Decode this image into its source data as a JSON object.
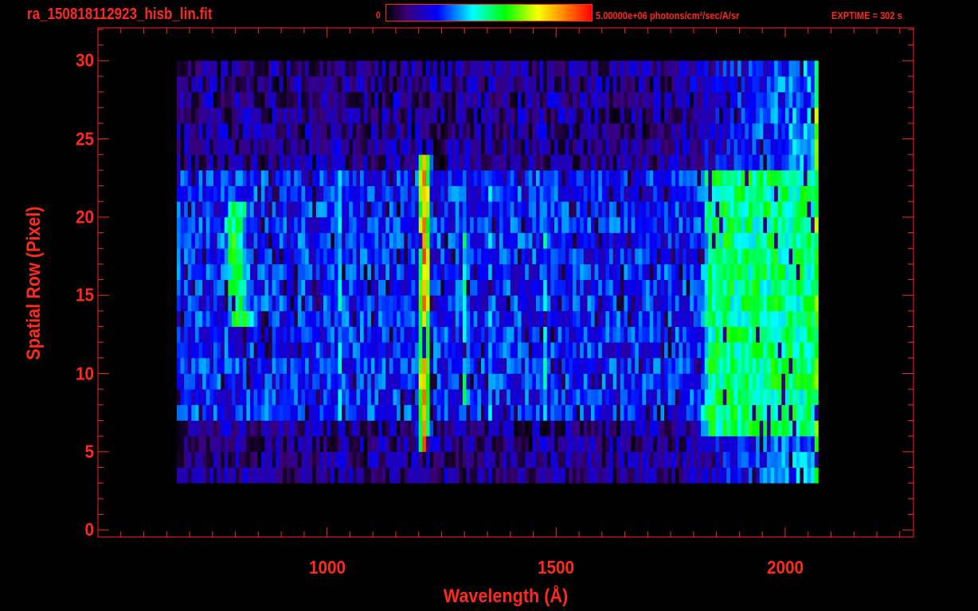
{
  "chart_data": {
    "type": "heatmap",
    "title": "ra_150818112923_hisb_lin.fit",
    "colorbar": {
      "min_label": "0",
      "max_label": "5.00000e+06 photons/cm²/sec/A/sr",
      "min": 0,
      "max": 5000000
    },
    "annotation": "EXPTIME = 302 s",
    "xlabel": "Wavelength (Å)",
    "ylabel": "Spatial Row (Pixel)",
    "xlim": [
      500,
      2280
    ],
    "ylim": [
      -0.45,
      32.1
    ],
    "x_ticks": [
      {
        "value": 1000,
        "label": "1000"
      },
      {
        "value": 1500,
        "label": "1500"
      },
      {
        "value": 2000,
        "label": "2000"
      }
    ],
    "x_minor_step": 50,
    "y_ticks": [
      {
        "value": 0,
        "label": "0"
      },
      {
        "value": 5,
        "label": "5"
      },
      {
        "value": 10,
        "label": "10"
      },
      {
        "value": 15,
        "label": "15"
      },
      {
        "value": 20,
        "label": "20"
      },
      {
        "value": 25,
        "label": "25"
      },
      {
        "value": 30,
        "label": "30"
      }
    ],
    "data_extent": {
      "wavelength": [
        672,
        2072
      ],
      "rows": [
        3,
        30
      ],
      "bin_width": 8
    },
    "background": {
      "all_rows_level": 0.13,
      "slit_rows": [
        7,
        23
      ],
      "slit_level": 0.26
    },
    "features": [
      {
        "name": "Lyman-alpha",
        "wavelength": 1212,
        "width": 14,
        "rows": [
          5,
          24
        ],
        "level": 0.85
      },
      {
        "name": "Lyman-beta",
        "wavelength": 1025,
        "width": 8,
        "rows": [
          7,
          23
        ],
        "level": 0.42
      },
      {
        "name": "O I 1304",
        "wavelength": 1300,
        "width": 9,
        "rows": [
          7,
          23
        ],
        "level": 0.42
      },
      {
        "name": "O I 1356",
        "wavelength": 1356,
        "width": 10,
        "rows": [
          7,
          23
        ],
        "level": 0.34
      },
      {
        "name": "N I 1493",
        "wavelength": 1478,
        "width": 8,
        "rows": [
          7,
          23
        ],
        "level": 0.4
      },
      {
        "name": "broad 830",
        "wavelength": 825,
        "width": 35,
        "rows": [
          13,
          21
        ],
        "level": 0.55
      },
      {
        "name": "continuum",
        "wavelength": 1930,
        "width": 130,
        "rows": [
          6,
          23
        ],
        "level": 0.5
      },
      {
        "name": "edge",
        "wavelength": 2066,
        "width": 4,
        "rows": [
          3,
          30
        ],
        "level": 0.78
      }
    ],
    "colormap": [
      "#000000",
      "#3c0078",
      "#0000ff",
      "#00ffff",
      "#00ff00",
      "#ffff00",
      "#ff8000",
      "#ff0000"
    ]
  }
}
